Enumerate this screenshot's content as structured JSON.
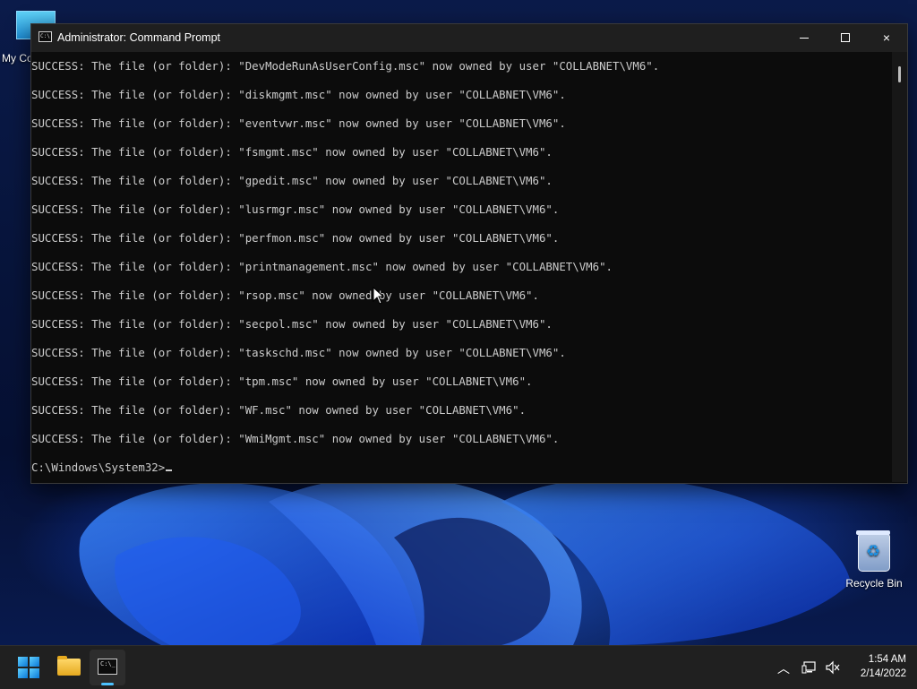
{
  "window": {
    "title": "Administrator: Command Prompt",
    "icon": "cmd-icon",
    "controls": {
      "minimize": "minimize-icon",
      "maximize": "maximize-icon",
      "close": "×"
    }
  },
  "console": {
    "lines": [
      "SUCCESS: The file (or folder): \"DevModeRunAsUserConfig.msc\" now owned by user \"COLLABNET\\VM6\".",
      "SUCCESS: The file (or folder): \"diskmgmt.msc\" now owned by user \"COLLABNET\\VM6\".",
      "SUCCESS: The file (or folder): \"eventvwr.msc\" now owned by user \"COLLABNET\\VM6\".",
      "SUCCESS: The file (or folder): \"fsmgmt.msc\" now owned by user \"COLLABNET\\VM6\".",
      "SUCCESS: The file (or folder): \"gpedit.msc\" now owned by user \"COLLABNET\\VM6\".",
      "SUCCESS: The file (or folder): \"lusrmgr.msc\" now owned by user \"COLLABNET\\VM6\".",
      "SUCCESS: The file (or folder): \"perfmon.msc\" now owned by user \"COLLABNET\\VM6\".",
      "SUCCESS: The file (or folder): \"printmanagement.msc\" now owned by user \"COLLABNET\\VM6\".",
      "SUCCESS: The file (or folder): \"rsop.msc\" now owned by user \"COLLABNET\\VM6\".",
      "SUCCESS: The file (or folder): \"secpol.msc\" now owned by user \"COLLABNET\\VM6\".",
      "SUCCESS: The file (or folder): \"taskschd.msc\" now owned by user \"COLLABNET\\VM6\".",
      "SUCCESS: The file (or folder): \"tpm.msc\" now owned by user \"COLLABNET\\VM6\".",
      "SUCCESS: The file (or folder): \"WF.msc\" now owned by user \"COLLABNET\\VM6\".",
      "SUCCESS: The file (or folder): \"WmiMgmt.msc\" now owned by user \"COLLABNET\\VM6\"."
    ],
    "prompt": "C:\\Windows\\System32>",
    "text_color": "#cccccc",
    "background": "#0c0c0c"
  },
  "desktop": {
    "icons": [
      {
        "label": "My Co",
        "icon": "computer-icon"
      },
      {
        "label": "Recycle Bin",
        "icon": "recycle-bin-icon"
      }
    ]
  },
  "taskbar": {
    "apps": [
      {
        "name": "Start",
        "icon": "windows-start-icon"
      },
      {
        "name": "File Explorer",
        "icon": "folder-icon"
      },
      {
        "name": "Command Prompt",
        "icon": "cmd-icon",
        "active": true
      }
    ],
    "tray": {
      "icons": [
        "chevron-up-icon",
        "network-icon",
        "volume-muted-icon"
      ],
      "time": "1:54 AM",
      "date": "2/14/2022"
    },
    "accent": "#4cc2ff"
  }
}
